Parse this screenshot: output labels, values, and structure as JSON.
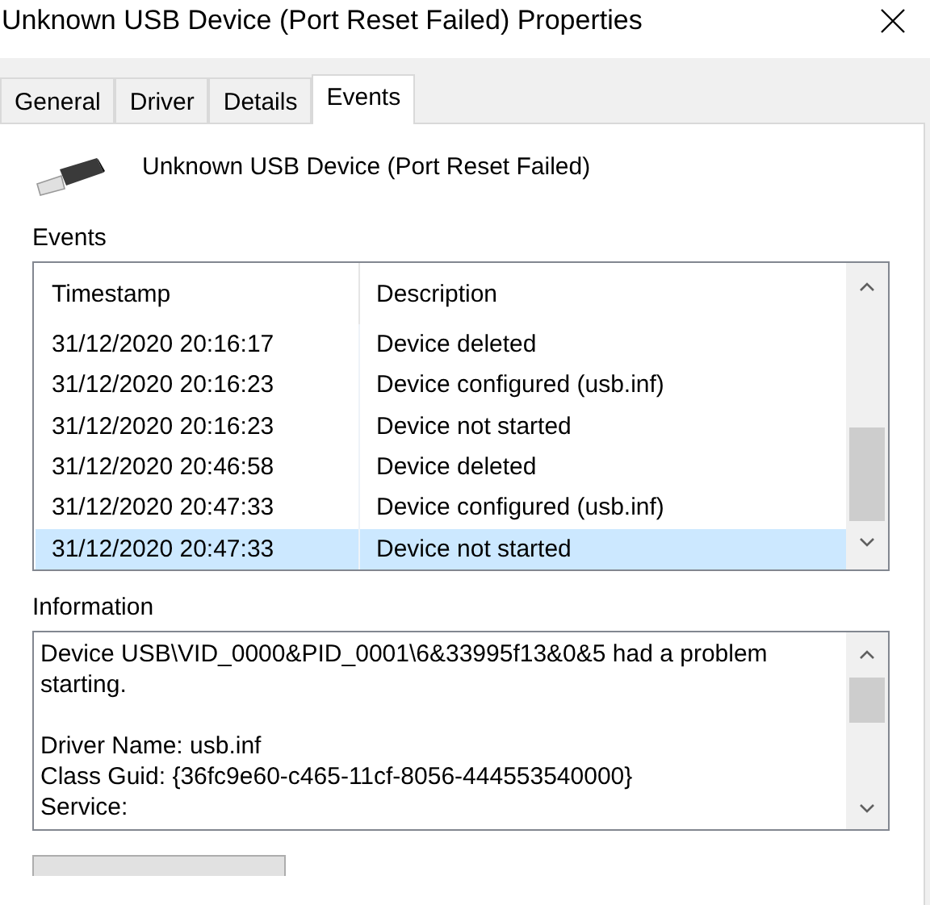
{
  "window": {
    "title": "Unknown USB Device (Port Reset Failed) Properties"
  },
  "tabs": [
    {
      "label": "General",
      "selected": false
    },
    {
      "label": "Driver",
      "selected": false
    },
    {
      "label": "Details",
      "selected": false
    },
    {
      "label": "Events",
      "selected": true
    }
  ],
  "device": {
    "name": "Unknown USB Device (Port Reset Failed)"
  },
  "events": {
    "label": "Events",
    "columns": [
      "Timestamp",
      "Description"
    ],
    "rows": [
      {
        "timestamp": "31/12/2020 20:16:17",
        "description": "Device deleted",
        "selected": false
      },
      {
        "timestamp": "31/12/2020 20:16:23",
        "description": "Device configured (usb.inf)",
        "selected": false
      },
      {
        "timestamp": "31/12/2020 20:16:23",
        "description": "Device not started",
        "selected": false
      },
      {
        "timestamp": "31/12/2020 20:46:58",
        "description": "Device deleted",
        "selected": false
      },
      {
        "timestamp": "31/12/2020 20:47:33",
        "description": "Device configured (usb.inf)",
        "selected": false
      },
      {
        "timestamp": "31/12/2020 20:47:33",
        "description": "Device not started",
        "selected": true
      }
    ]
  },
  "information": {
    "label": "Information",
    "text": "Device USB\\VID_0000&PID_0001\\6&33995f13&0&5 had a problem starting.\n\nDriver Name: usb.inf\nClass Guid: {36fc9e60-c465-11cf-8056-444553540000}\nService:"
  }
}
